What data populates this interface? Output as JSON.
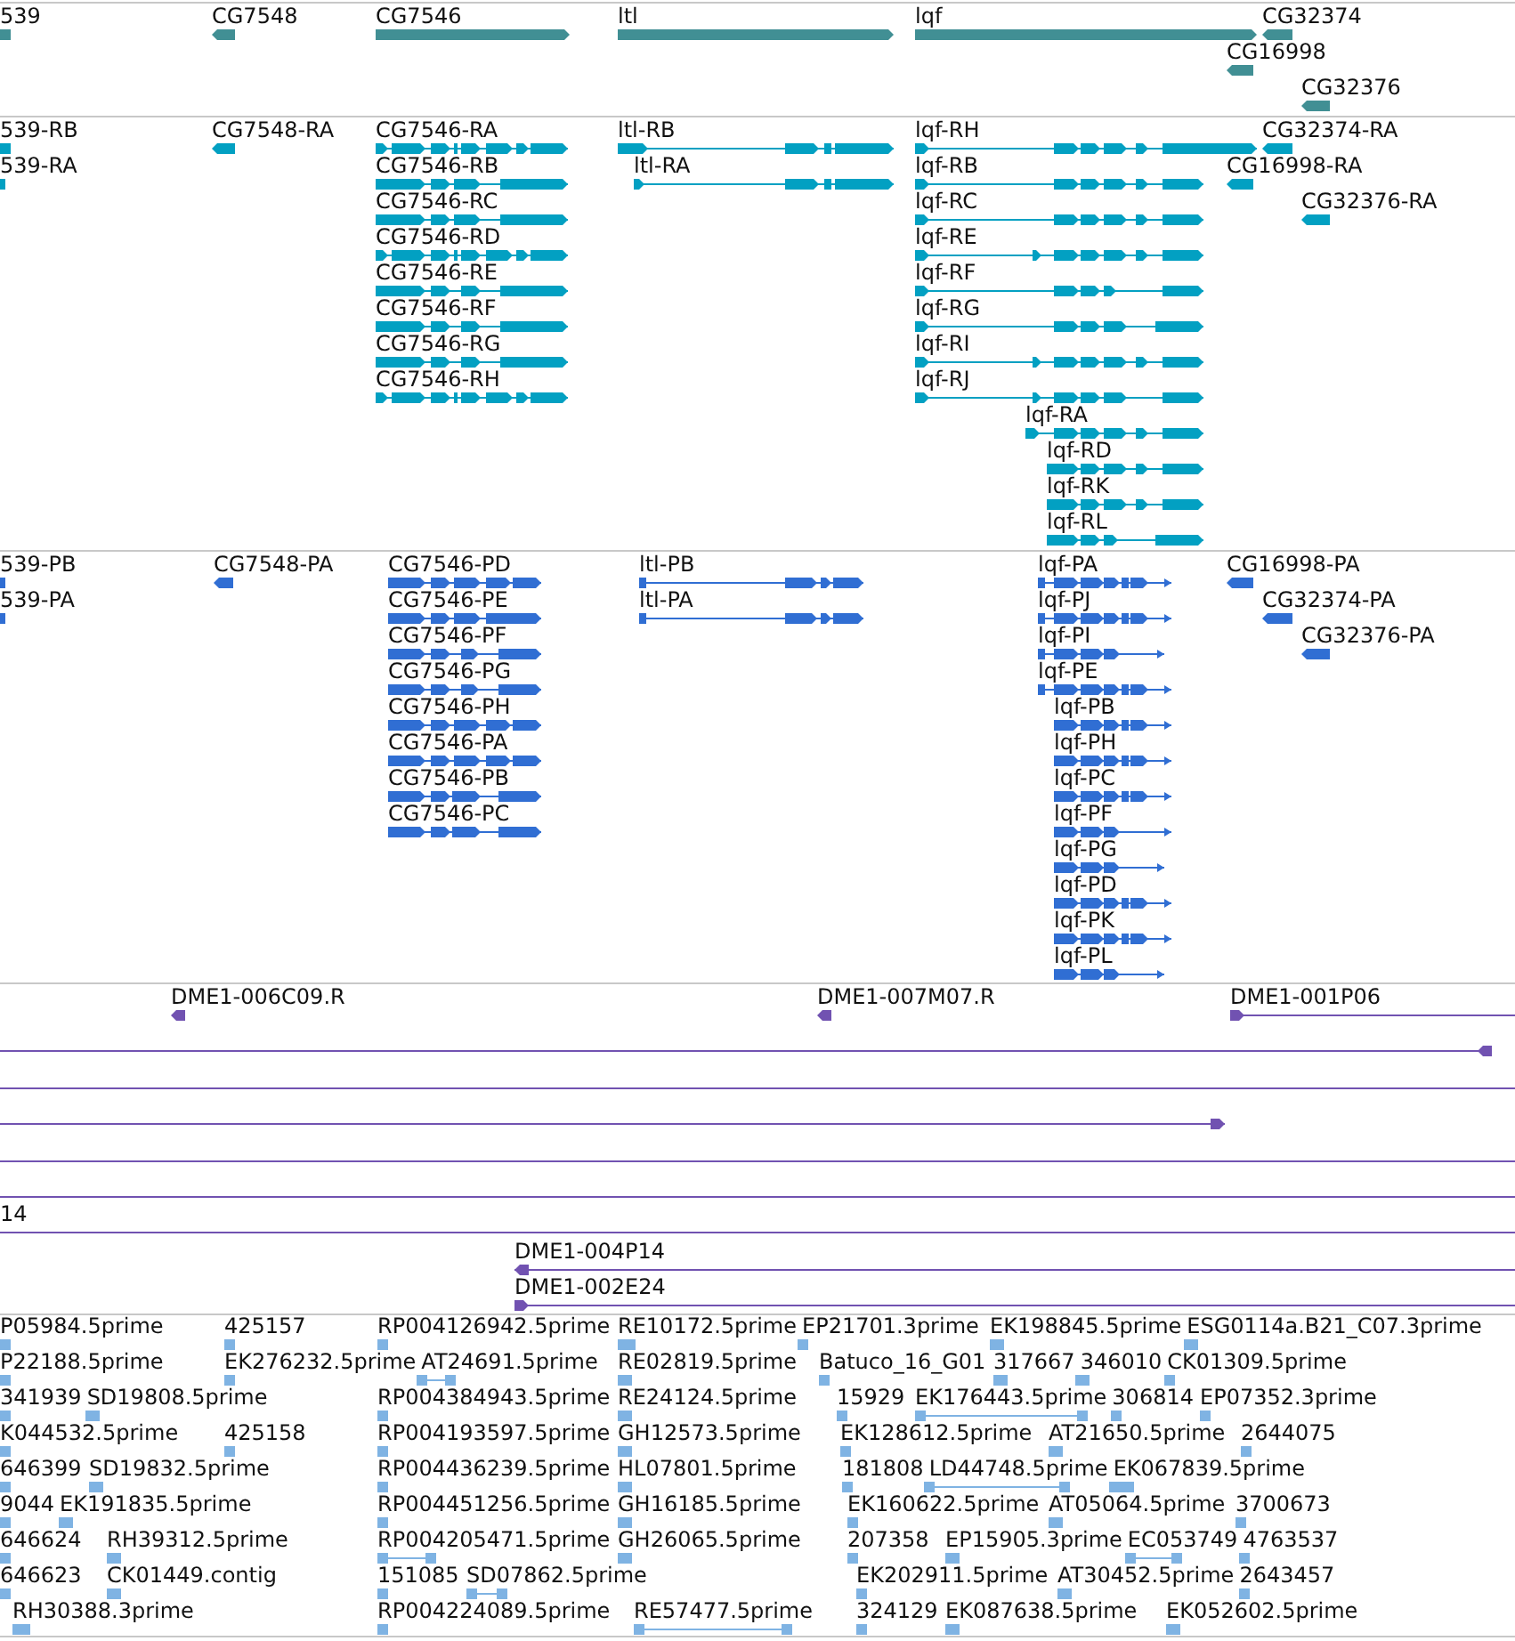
{
  "tracks": [
    {
      "kind": "gene",
      "rows": [
        {
          "features": [
            {
              "label": "539"
            },
            {
              "label": "CG7548",
              "reverse": true
            },
            {
              "label": "CG7546",
              "reverse": false
            },
            {
              "label": "ltl",
              "reverse": false
            },
            {
              "label": "lqf",
              "reverse": false
            },
            {
              "label": "CG32374",
              "reverse": true
            }
          ]
        },
        {
          "features": [
            {
              "label": "CG16998",
              "reverse": true
            }
          ]
        },
        {
          "features": [
            {
              "label": "CG32376",
              "reverse": true
            }
          ]
        }
      ]
    },
    {
      "kind": "transcript",
      "rows": [
        {
          "features": [
            {
              "label": "539-RB"
            },
            {
              "label": "CG7548-RA",
              "reverse": true
            },
            {
              "label": "CG7546-RA",
              "reverse": false
            },
            {
              "label": "ltl-RB",
              "reverse": false
            },
            {
              "label": "lqf-RH",
              "reverse": false
            },
            {
              "label": "CG32374-RA",
              "reverse": true
            }
          ]
        },
        {
          "features": [
            {
              "label": "539-RA"
            },
            {
              "label": "CG7546-RB",
              "reverse": false
            },
            {
              "label": "ltl-RA",
              "reverse": false
            },
            {
              "label": "lqf-RB",
              "reverse": false
            },
            {
              "label": "CG16998-RA",
              "reverse": true
            }
          ]
        },
        {
          "features": [
            {
              "label": "CG7546-RC",
              "reverse": false
            },
            {
              "label": "lqf-RC",
              "reverse": false
            },
            {
              "label": "CG32376-RA",
              "reverse": true
            }
          ]
        },
        {
          "features": [
            {
              "label": "CG7546-RD",
              "reverse": false
            },
            {
              "label": "lqf-RE",
              "reverse": false
            }
          ]
        },
        {
          "features": [
            {
              "label": "CG7546-RE",
              "reverse": false
            },
            {
              "label": "lqf-RF",
              "reverse": false
            }
          ]
        },
        {
          "features": [
            {
              "label": "CG7546-RF",
              "reverse": false
            },
            {
              "label": "lqf-RG",
              "reverse": false
            }
          ]
        },
        {
          "features": [
            {
              "label": "CG7546-RG",
              "reverse": false
            },
            {
              "label": "lqf-RI",
              "reverse": false
            }
          ]
        },
        {
          "features": [
            {
              "label": "CG7546-RH",
              "reverse": false
            },
            {
              "label": "lqf-RJ",
              "reverse": false
            }
          ]
        },
        {
          "features": [
            {
              "label": "lqf-RA",
              "reverse": false
            }
          ]
        },
        {
          "features": [
            {
              "label": "lqf-RD",
              "reverse": false
            }
          ]
        },
        {
          "features": [
            {
              "label": "lqf-RK",
              "reverse": false
            }
          ]
        },
        {
          "features": [
            {
              "label": "lqf-RL",
              "reverse": false
            }
          ]
        }
      ]
    },
    {
      "kind": "protein",
      "rows": [
        {
          "features": [
            {
              "label": "539-PB"
            },
            {
              "label": "CG7548-PA",
              "reverse": true
            },
            {
              "label": "CG7546-PD",
              "reverse": false
            },
            {
              "label": "ltl-PB",
              "reverse": false
            },
            {
              "label": "lqf-PA",
              "reverse": false
            },
            {
              "label": "CG16998-PA",
              "reverse": true
            }
          ]
        },
        {
          "features": [
            {
              "label": "539-PA"
            },
            {
              "label": "CG7546-PE",
              "reverse": false
            },
            {
              "label": "ltl-PA",
              "reverse": false
            },
            {
              "label": "lqf-PJ",
              "reverse": false
            },
            {
              "label": "CG32374-PA",
              "reverse": true
            }
          ]
        },
        {
          "features": [
            {
              "label": "CG7546-PF",
              "reverse": false
            },
            {
              "label": "lqf-PI",
              "reverse": false
            },
            {
              "label": "CG32376-PA",
              "reverse": true
            }
          ]
        },
        {
          "features": [
            {
              "label": "CG7546-PG",
              "reverse": false
            },
            {
              "label": "lqf-PE",
              "reverse": false
            }
          ]
        },
        {
          "features": [
            {
              "label": "CG7546-PH",
              "reverse": false
            },
            {
              "label": "lqf-PB",
              "reverse": false
            }
          ]
        },
        {
          "features": [
            {
              "label": "CG7546-PA",
              "reverse": false
            },
            {
              "label": "lqf-PH",
              "reverse": false
            }
          ]
        },
        {
          "features": [
            {
              "label": "CG7546-PB",
              "reverse": false
            },
            {
              "label": "lqf-PC",
              "reverse": false
            }
          ]
        },
        {
          "features": [
            {
              "label": "CG7546-PC",
              "reverse": false
            },
            {
              "label": "lqf-PF",
              "reverse": false
            }
          ]
        },
        {
          "features": [
            {
              "label": "lqf-PG",
              "reverse": false
            }
          ]
        },
        {
          "features": [
            {
              "label": "lqf-PD",
              "reverse": false
            }
          ]
        },
        {
          "features": [
            {
              "label": "lqf-PK",
              "reverse": false
            }
          ]
        },
        {
          "features": [
            {
              "label": "lqf-PL",
              "reverse": false
            }
          ]
        }
      ]
    },
    {
      "kind": "clone",
      "rows": [
        {
          "features": [
            {
              "kind": "block",
              "label": "DME1-006C09.R",
              "reverse": true
            },
            {
              "kind": "block",
              "label": "DME1-007M07.R",
              "reverse": true
            },
            {
              "kind": "line",
              "label": "DME1-001P06",
              "reverse": false
            }
          ]
        },
        {
          "features": [
            {
              "kind": "line",
              "reverse": true
            }
          ]
        },
        {
          "features": [
            {
              "kind": "line"
            }
          ]
        },
        {
          "features": [
            {
              "kind": "line",
              "reverse": false
            }
          ]
        },
        {
          "features": [
            {
              "kind": "line"
            }
          ]
        },
        {
          "features": [
            {
              "kind": "line"
            }
          ]
        },
        {
          "features": [
            {
              "kind": "line",
              "label": "14"
            }
          ]
        },
        {
          "features": [
            {
              "kind": "line",
              "label": "DME1-004P14",
              "reverse": true
            }
          ]
        },
        {
          "features": [
            {
              "kind": "line",
              "label": "DME1-002E24",
              "reverse": false
            }
          ]
        }
      ]
    },
    {
      "kind": "est",
      "rows": [
        {
          "features": [
            {
              "label": "P05984.5prime"
            },
            {
              "label": "425157"
            },
            {
              "label": "RP004126942.5prime"
            },
            {
              "label": "RE10172.5prime"
            },
            {
              "label": "EP21701.3prime"
            },
            {
              "label": "EK198845.5prime"
            },
            {
              "label": "ESG0114a.B21_C07.3prime"
            }
          ]
        },
        {
          "features": [
            {
              "label": "P22188.5prime"
            },
            {
              "label": "EK276232.5prime"
            },
            {
              "label": "AT24691.5prime"
            },
            {
              "label": "RE02819.5prime"
            },
            {
              "label": "Batuco_16_G01"
            },
            {
              "label": "317667"
            },
            {
              "label": "346010"
            },
            {
              "label": "CK01309.5prime"
            }
          ]
        },
        {
          "features": [
            {
              "label": "341939"
            },
            {
              "label": "SD19808.5prime"
            },
            {
              "label": "RP004384943.5prime"
            },
            {
              "label": "RE24124.5prime"
            },
            {
              "label": "15929"
            },
            {
              "label": "EK176443.5prime"
            },
            {
              "label": "306814"
            },
            {
              "label": "EP07352.3prime"
            }
          ]
        },
        {
          "features": [
            {
              "label": "K044532.5prime"
            },
            {
              "label": "425158"
            },
            {
              "label": "RP004193597.5prime"
            },
            {
              "label": "GH12573.5prime"
            },
            {
              "label": "EK128612.5prime"
            },
            {
              "label": "AT21650.5prime"
            },
            {
              "label": "2644075"
            }
          ]
        },
        {
          "features": [
            {
              "label": "646399"
            },
            {
              "label": "SD19832.5prime"
            },
            {
              "label": "RP004436239.5prime"
            },
            {
              "label": "HL07801.5prime"
            },
            {
              "label": "181808"
            },
            {
              "label": "LD44748.5prime"
            },
            {
              "label": "EK067839.5prime"
            }
          ]
        },
        {
          "features": [
            {
              "label": "9044"
            },
            {
              "label": "EK191835.5prime"
            },
            {
              "label": "RP004451256.5prime"
            },
            {
              "label": "GH16185.5prime"
            },
            {
              "label": "EK160622.5prime"
            },
            {
              "label": "AT05064.5prime"
            },
            {
              "label": "3700673"
            }
          ]
        },
        {
          "features": [
            {
              "label": "646624"
            },
            {
              "label": "RH39312.5prime"
            },
            {
              "label": "RP004205471.5prime"
            },
            {
              "label": "GH26065.5prime"
            },
            {
              "label": "207358"
            },
            {
              "label": "EP15905.3prime"
            },
            {
              "label": "EC053749"
            },
            {
              "label": "4763537"
            }
          ]
        },
        {
          "features": [
            {
              "label": "646623"
            },
            {
              "label": "CK01449.contig"
            },
            {
              "label": "151085"
            },
            {
              "label": "SD07862.5prime"
            },
            {
              "label": "EK202911.5prime"
            },
            {
              "label": "AT30452.5prime"
            },
            {
              "label": "2643457"
            }
          ]
        },
        {
          "features": [
            {
              "label": "RH30388.3prime"
            },
            {
              "label": "RP004224089.5prime"
            },
            {
              "label": "RE57477.5prime"
            },
            {
              "label": "324129"
            },
            {
              "label": "EK087638.5prime"
            },
            {
              "label": "EK052602.5prime"
            }
          ]
        }
      ]
    }
  ]
}
